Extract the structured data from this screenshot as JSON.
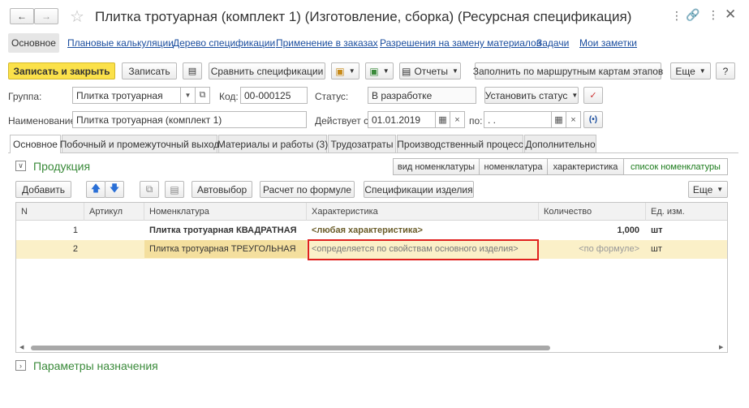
{
  "window": {
    "title": "Плитка тротуарная (комплект 1) (Изготовление, сборка) (Ресурсная спецификация)"
  },
  "nav_tabs": [
    "Основное",
    "Плановые калькуляции",
    "Дерево спецификации",
    "Применение в заказах",
    "Разрешения на замену материалов",
    "Задачи",
    "Мои заметки"
  ],
  "toolbar": {
    "save_close": "Записать и закрыть",
    "save": "Записать",
    "compare": "Сравнить спецификации",
    "reports": "Отчеты",
    "fill_by_routes": "Заполнить по маршрутным картам этапов",
    "more": "Еще",
    "help": "?"
  },
  "form": {
    "group_label": "Группа:",
    "group_value": "Плитка тротуарная",
    "code_label": "Код:",
    "code_value": "00-000125",
    "status_label": "Статус:",
    "status_value": "В разработке",
    "set_status": "Установить статус",
    "name_label": "Наименование:",
    "name_value": "Плитка тротуарная (комплект 1)",
    "valid_from_label": "Действует с:",
    "valid_from_value": "01.01.2019",
    "valid_to_label": "по:",
    "valid_to_value": " .  ."
  },
  "tabs": [
    "Основное",
    "Побочный и промежуточный выход",
    "Материалы и работы (3)",
    "Трудозатраты",
    "Производственный процесс",
    "Дополнительно"
  ],
  "products": {
    "title": "Продукция",
    "view_buttons": [
      "вид номенклатуры",
      "номенклатура",
      "характеристика",
      "список номенклатуры"
    ],
    "add": "Добавить",
    "autoselect": "Автовыбор",
    "calc_formula": "Расчет по формуле",
    "item_specs": "Спецификации изделия",
    "more": "Еще",
    "columns": [
      "N",
      "Артикул",
      "Номенклатура",
      "Характеристика",
      "Количество",
      "Ед. изм."
    ],
    "rows": [
      {
        "n": "1",
        "article": "",
        "item": "Плитка тротуарная КВАДРАТНАЯ",
        "characteristic": "<любая характеристика>",
        "qty": "1,000",
        "unit": "шт"
      },
      {
        "n": "2",
        "article": "",
        "item": "Плитка тротуарная ТРЕУГОЛЬНАЯ",
        "characteristic": "<определяется по свойствам основного изделия>",
        "qty": "<по формуле>",
        "unit": "шт"
      }
    ]
  },
  "params_section": "Параметры назначения",
  "colors": {
    "accent_yellow": "#fbe14a",
    "selected_row": "#fbf0c8",
    "highlight_red": "#e0201e",
    "section_green": "#3a8a3a",
    "link_blue": "#1a4d9e"
  }
}
